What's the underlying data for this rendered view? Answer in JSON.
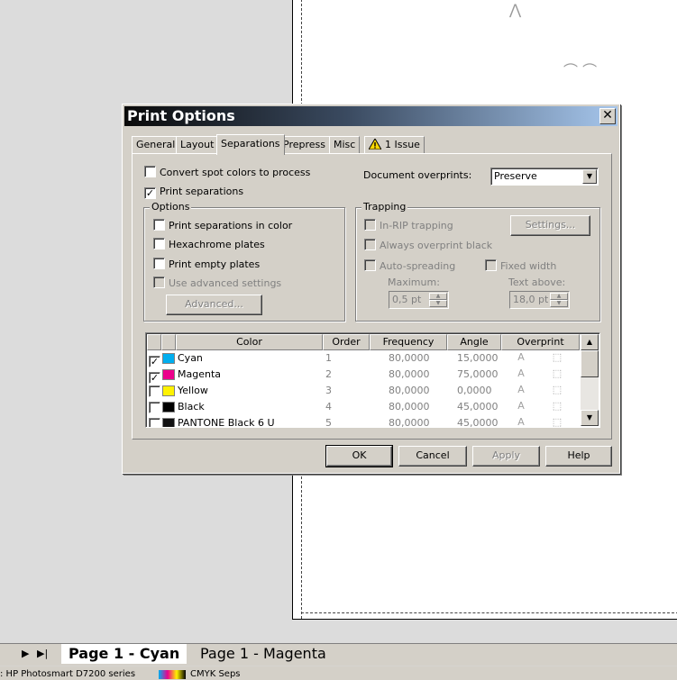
{
  "dialog": {
    "title": "Print Options",
    "close_glyph": "✕"
  },
  "tabs": [
    {
      "label": "General"
    },
    {
      "label": "Layout"
    },
    {
      "label": "Separations"
    },
    {
      "label": "Prepress"
    },
    {
      "label": "Misc"
    },
    {
      "label": "1 Issue"
    }
  ],
  "separations": {
    "convert_spot": {
      "label": "Convert spot colors to process",
      "checked": false
    },
    "print_separations": {
      "label": "Print separations",
      "checked": true
    },
    "doc_overprints_label": "Document overprints:",
    "doc_overprints_value": "Preserve"
  },
  "options_group": {
    "title": "Options",
    "in_color": "Print separations in color",
    "hexachrome": "Hexachrome plates",
    "empty_plates": "Print empty plates",
    "advanced_settings": "Use advanced settings",
    "advanced_button": "Advanced..."
  },
  "trapping_group": {
    "title": "Trapping",
    "in_rip": "In-RIP trapping",
    "settings_button": "Settings...",
    "always_overprint": "Always overprint black",
    "auto_spreading": "Auto-spreading",
    "fixed_width": "Fixed width",
    "maximum_label": "Maximum:",
    "maximum_value": "0,5 pt",
    "text_above_label": "Text above:",
    "text_above_value": "18,0 pt"
  },
  "table": {
    "headers": [
      "Color",
      "Order",
      "Frequency",
      "Angle",
      "Overprint"
    ],
    "rows": [
      {
        "checked": true,
        "color": "Cyan",
        "swatch": "#00aeef",
        "order": "1",
        "frequency": "80,0000",
        "angle": "15,0000"
      },
      {
        "checked": true,
        "color": "Magenta",
        "swatch": "#ec008c",
        "order": "2",
        "frequency": "80,0000",
        "angle": "75,0000"
      },
      {
        "checked": false,
        "color": "Yellow",
        "swatch": "#fff200",
        "order": "3",
        "frequency": "80,0000",
        "angle": "0,0000"
      },
      {
        "checked": false,
        "color": "Black",
        "swatch": "#000000",
        "order": "4",
        "frequency": "80,0000",
        "angle": "45,0000"
      },
      {
        "checked": false,
        "color": "PANTONE Black 6 U",
        "swatch": "#111111",
        "order": "5",
        "frequency": "80,0000",
        "angle": "45,0000"
      }
    ]
  },
  "buttons": {
    "ok": "OK",
    "cancel": "Cancel",
    "apply": "Apply",
    "help": "Help"
  },
  "page_tabs": {
    "active": "Page 1 - Cyan",
    "other": "Page 1 - Magenta"
  },
  "status": {
    "printer": ": HP Photosmart D7200 series",
    "mode": "CMYK Seps"
  }
}
